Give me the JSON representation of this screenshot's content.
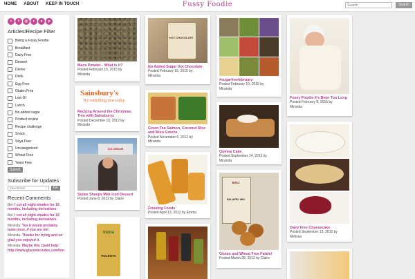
{
  "topbar": {
    "nav": [
      "HOME",
      "ABOUT",
      "KEEP IN TOUCH"
    ],
    "brand": "Fussy Foodie",
    "search_placeholder": "Search",
    "search_button": "Search"
  },
  "sidebar": {
    "social_icons": [
      "twitter-icon",
      "facebook-icon",
      "email-icon",
      "rss-icon",
      "stumble-icon",
      "pinterest-icon"
    ],
    "filter_title": "Articles/Recipe Filter",
    "filters": [
      "Being a Fussy Foodie",
      "Breakfast",
      "Dairy Free",
      "Dessert",
      "Dinner",
      "Drink",
      "Egg Free",
      "Gluten Free",
      "Low GI",
      "Lunch",
      "No added sugar",
      "Product review",
      "Recipe challenge",
      "Snack",
      "Soya Free",
      "Uncategorized",
      "Wheat Free",
      "Yeast Free"
    ],
    "submit_label": "Submit",
    "subscribe_title": "Subscribe for Updates",
    "email_placeholder": "Your Email",
    "go_label": "Go",
    "recent_title": "Recent Comments",
    "comments": [
      {
        "author": "Bel",
        "link": "I cut all night-shades for 18 months, including derivatives"
      },
      {
        "author": "Bel",
        "link": "I cut all night-shades for 18 months, including derivatives"
      },
      {
        "author": "Miranda",
        "link": "Yes it would probably taste nicer, if you are not"
      },
      {
        "author": "Miranda",
        "link": "Thanks for trying and so glad you enjoyed it."
      },
      {
        "author": "Miranda",
        "link": "Maybe this could help: http://www.glycemicindex.com/foo"
      }
    ]
  },
  "cards": {
    "maca": {
      "title": "Maca Powder - What is it?",
      "date": "Posted February 15, 2015 by",
      "author": "Miranda"
    },
    "sainsburys": {
      "title": "Rocking Around the Christmas Tree with Sainsburys",
      "date": "Posted December 10, 2012 by",
      "author": "Miranda",
      "logo": "Sainsbury's",
      "tagline": "Try something new today"
    },
    "stylee": {
      "title": "Stylee Sheeps Milk Iced Dessert",
      "date": "Posted June 8, 2012 by Claire",
      "author": "",
      "sign": "ICE CREAM"
    },
    "polenta": {
      "brand": "biona",
      "label": "POLENTA"
    },
    "chocolate": {
      "title": "No Added Sugar Hot Chocolate",
      "date": "Posted February 15, 2015 by",
      "author": "Miranda",
      "jar_text": "HOT CHOCOLATE"
    },
    "salmon": {
      "title": "Green Tea Salmon, Coconut Rice and Miso Greens",
      "date": "Posted November 6, 2012 by",
      "author": "Miranda"
    },
    "freezing": {
      "title": "Freezing Foods",
      "date": "Posted April 13, 2012 by Emma"
    },
    "sugarfree": {
      "title": "#sugarfreefebruary",
      "date": "Posted February 10, 2015 by",
      "author": "Miranda"
    },
    "quinoa": {
      "title": "Quinoa Cake",
      "date": "Posted September 14, 2012 by",
      "author": "Miranda"
    },
    "falafel": {
      "title": "Gluten and Wheat Free Falafel",
      "date": "Posted March 28, 2012 by Claire",
      "pack_brand": "BALI",
      "pack_name": "FALAFEL MIX"
    },
    "baby": {
      "title": "Fussy Foodie it's Been Too Long",
      "date": "Posted February 8, 2015 by",
      "author": "Miranda"
    },
    "cheesecake": {
      "title": "Dairy Free Cheesecake",
      "date": "Posted September 13, 2012 by",
      "author": "Melissa"
    }
  }
}
